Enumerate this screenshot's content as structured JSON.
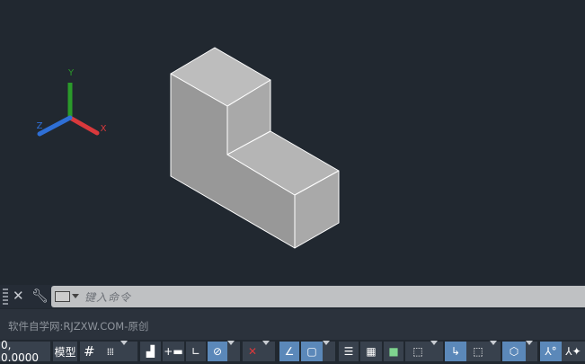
{
  "viewport": {
    "ucs": {
      "x_label": "X",
      "y_label": "Y",
      "z_label": "Z"
    },
    "colors": {
      "background": "#212830",
      "x_axis": "#d9393c",
      "y_axis": "#2a9a2a",
      "z_axis": "#2e6fd6"
    }
  },
  "command_line": {
    "placeholder": "键入命令",
    "icons": [
      "grip-icon",
      "close-icon",
      "wrench-icon",
      "command-prompt-icon"
    ]
  },
  "history": {
    "text": "软件自学网:RJZXW.COM-原创"
  },
  "status_bar": {
    "coordinates": "0, 0.0000",
    "model_label": "模型",
    "buttons": [
      "grid",
      "snap",
      "infer-constraints",
      "dynamic-input",
      "ortho",
      "polar",
      "isodraft",
      "osnap-tracking",
      "osnap",
      "lineweight",
      "transparency",
      "selection-cycling",
      "3d-osnap",
      "dynamic-ucs",
      "selection-filter",
      "gizmo",
      "annotation-visibility",
      "auto-scale"
    ]
  }
}
